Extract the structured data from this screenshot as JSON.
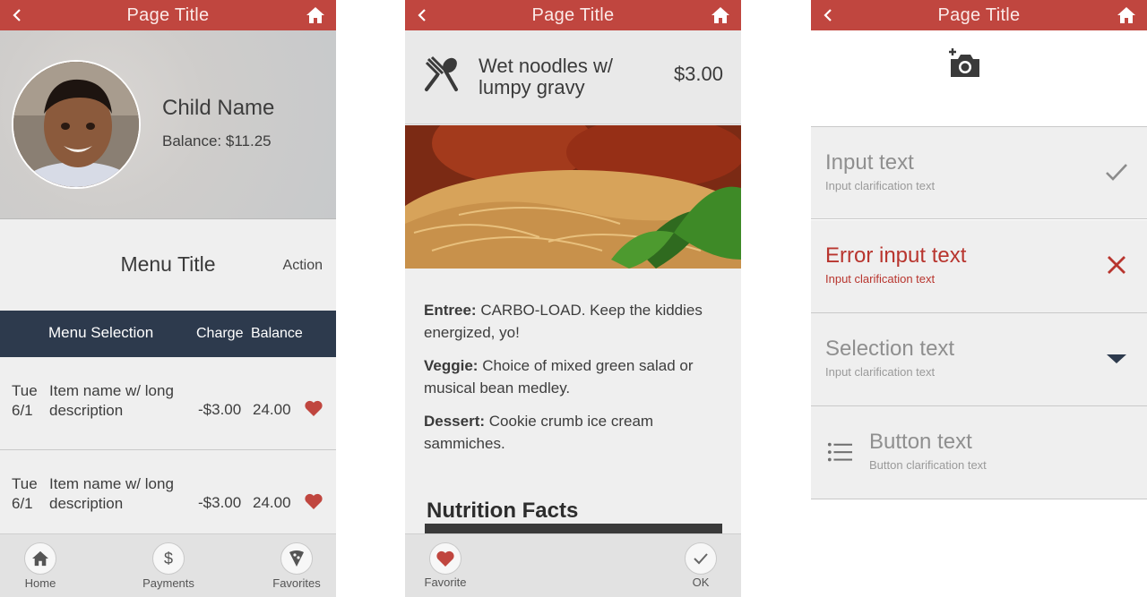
{
  "screens": {
    "account": {
      "title": "Page Title",
      "child_name": "Child Name",
      "balance": "Balance: $11.25",
      "menu_title": "Menu Title",
      "menu_action": "Action",
      "columns": {
        "selection": "Menu Selection",
        "charge": "Charge",
        "balance": "Balance"
      },
      "rows": [
        {
          "day": "Tue",
          "date": "6/1",
          "item": "Item name w/ long description",
          "charge": "-$3.00",
          "balance": "24.00"
        },
        {
          "day": "Tue",
          "date": "6/1",
          "item": "Item name w/ long description",
          "charge": "-$3.00",
          "balance": "24.00"
        }
      ],
      "tabs": [
        {
          "label": "Home",
          "icon": "home-icon"
        },
        {
          "label": "Payments",
          "icon": "dollar-icon"
        },
        {
          "label": "Favorites",
          "icon": "pizza-icon"
        }
      ]
    },
    "dish": {
      "title": "Page Title",
      "name": "Wet noodles w/ lumpy gravy",
      "price": "$3.00",
      "entree_label": "Entree:",
      "entree_text": "CARBO-LOAD. Keep the kiddies energized, yo!",
      "veggie_label": "Veggie:",
      "veggie_text": "Choice of mixed green salad or musical bean medley.",
      "dessert_label": "Dessert:",
      "dessert_text": "Cookie crumb ice cream sammiches.",
      "nutrition_title": "Nutrition Facts",
      "tabs": [
        {
          "label": "Favorite",
          "icon": "heart-icon"
        },
        {
          "label": "OK",
          "icon": "check-icon"
        }
      ]
    },
    "form": {
      "title": "Page Title",
      "fields": [
        {
          "text": "Input text",
          "clarification": "Input clarification text",
          "state": "valid"
        },
        {
          "text": "Error input text",
          "clarification": "Input clarification text",
          "state": "error"
        },
        {
          "text": "Selection text",
          "clarification": "Input clarification text",
          "state": "select"
        },
        {
          "text": "Button text",
          "clarification": "Button clarification text",
          "state": "button"
        }
      ]
    }
  },
  "colors": {
    "header": "#c0463f",
    "navy": "#2d3a4d",
    "error": "#b8352e",
    "heart": "#c0463f"
  }
}
